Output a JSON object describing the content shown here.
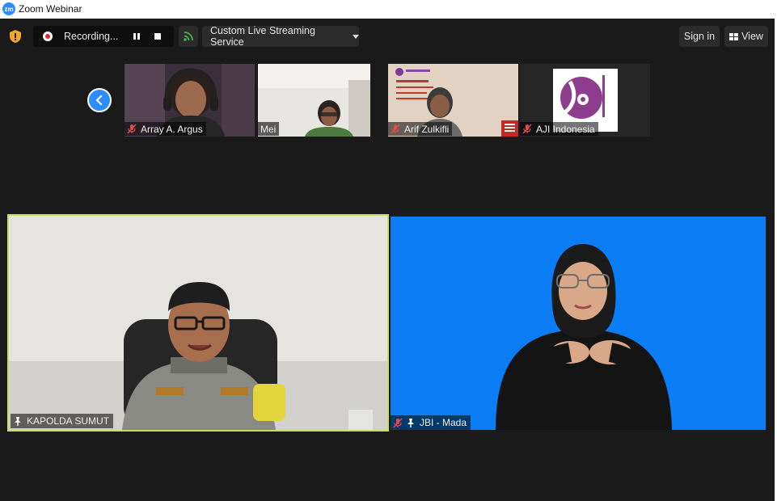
{
  "window": {
    "title": "Zoom Webinar",
    "logo_text": "zm"
  },
  "toolbar": {
    "security_icon": "shield-icon",
    "recording_label": "Recording...",
    "stream_service_label": "Custom Live Streaming Service",
    "signin_label": "Sign in",
    "view_label": "View"
  },
  "thumbnails": [
    {
      "name": "Array A. Argus",
      "muted": true
    },
    {
      "name": "Mei",
      "muted": false
    },
    {
      "name": "Arif Zulkifli",
      "muted": true
    },
    {
      "name": "AJI Indonesia",
      "muted": true
    }
  ],
  "speakers": [
    {
      "name": "KAPOLDA SUMUT",
      "pinned": true,
      "muted": false,
      "active": true
    },
    {
      "name": "JBI - Mada",
      "pinned": true,
      "muted": true,
      "active": false
    }
  ],
  "colors": {
    "accent": "#2d8cff",
    "active_speaker_border": "#c8e05a",
    "interpreter_bg": "#0b7ef5",
    "muted_red": "#e24b4b"
  }
}
